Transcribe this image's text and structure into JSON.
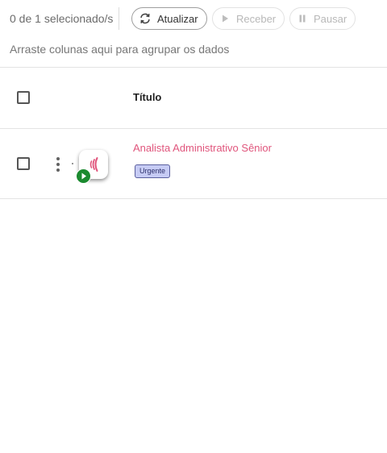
{
  "toolbar": {
    "selection_count": "0 de 1 selecionado/s",
    "refresh_label": "Atualizar",
    "receive_label": "Receber",
    "pause_label": "Pausar"
  },
  "group_hint": "Arraste colunas aqui para agrupar os dados",
  "table": {
    "columns": [
      "Título"
    ],
    "rows": [
      {
        "title": "Analista Administrativo Sênior",
        "badge": "Urgente"
      }
    ]
  },
  "colors": {
    "title_accent": "#e0557c",
    "badge_bg": "#c6cbf4",
    "play_green": "#1b8a2f"
  },
  "icons": [
    "refresh-icon",
    "play-icon",
    "pause-icon",
    "kebab-menu-icon",
    "sound-wave-icon",
    "play-badge-icon"
  ]
}
